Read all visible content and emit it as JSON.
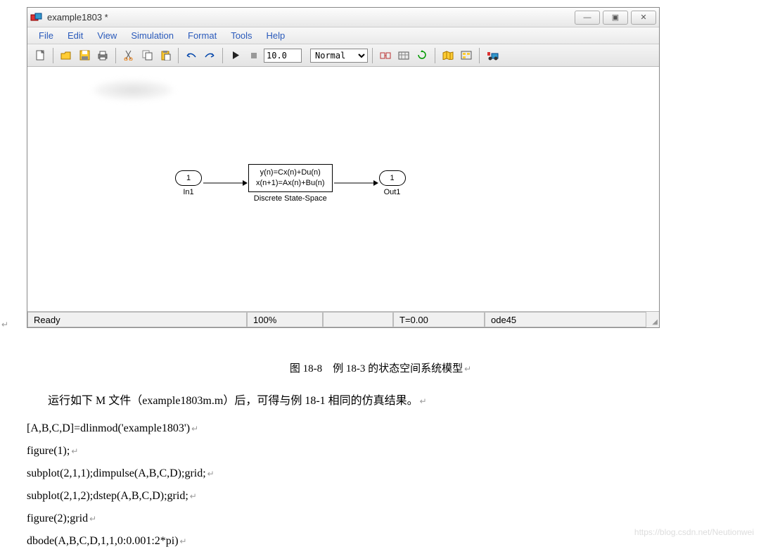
{
  "window": {
    "title": "example1803 *"
  },
  "menu": {
    "items": [
      "File",
      "Edit",
      "View",
      "Simulation",
      "Format",
      "Tools",
      "Help"
    ]
  },
  "toolbar": {
    "stop_time": "10.0",
    "mode": "Normal"
  },
  "diagram": {
    "in_port": {
      "num": "1",
      "label": "In1"
    },
    "state_block": {
      "line1": "y(n)=Cx(n)+Du(n)",
      "line2": "x(n+1)=Ax(n)+Bu(n)",
      "label": "Discrete State-Space"
    },
    "out_port": {
      "num": "1",
      "label": "Out1"
    }
  },
  "statusbar": {
    "ready": "Ready",
    "zoom": "100%",
    "time": "T=0.00",
    "solver": "ode45"
  },
  "caption": "图 18-8　例 18-3 的状态空间系统模型",
  "desc": "运行如下 M 文件（example1803m.m）后，可得与例 18-1 相同的仿真结果。",
  "code": {
    "l1": "[A,B,C,D]=dlinmod('example1803')",
    "l2": "figure(1);",
    "l3": "subplot(2,1,1);dimpulse(A,B,C,D);grid;",
    "l4": "subplot(2,1,2);dstep(A,B,C,D);grid;",
    "l5": "figure(2);grid",
    "l6": "dbode(A,B,C,D,1,1,0:0.001:2*pi)"
  },
  "watermark": "https://blog.csdn.net/Neutionwei"
}
